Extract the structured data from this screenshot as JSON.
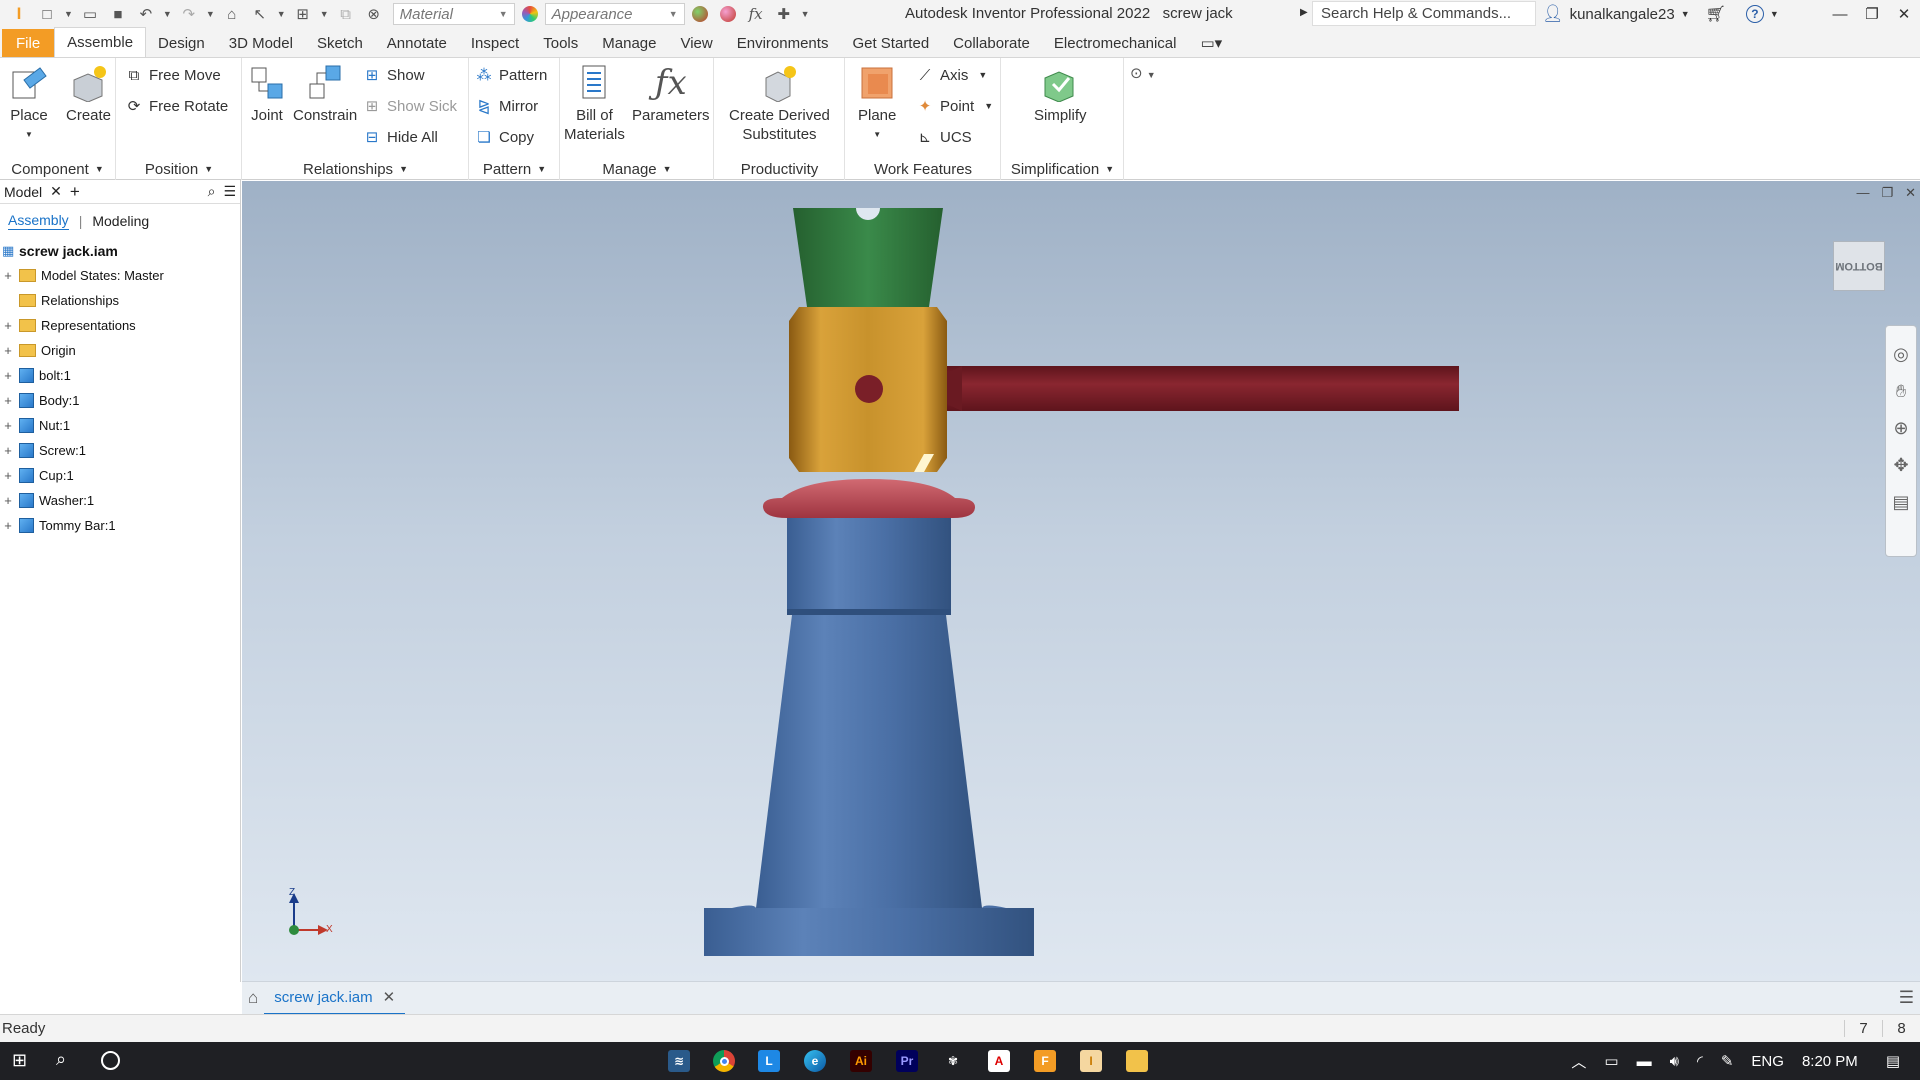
{
  "app": {
    "title": "Autodesk Inventor Professional 2022",
    "document": "screw jack",
    "colors": {
      "file_tab": "#f39c25",
      "accent": "#1a73c8",
      "viewport_top": "#9fb1c6",
      "viewport_bottom": "#dfe7f0"
    }
  },
  "qat": {
    "material_placeholder": "Material",
    "appearance_placeholder": "Appearance",
    "fx_label": "fx",
    "icons": [
      "inventor-logo-icon",
      "new-icon",
      "open-icon",
      "save-icon",
      "undo-icon",
      "redo-icon",
      "home-icon",
      "select-icon",
      "measure-icon",
      "color-icon",
      "clear-override-icon",
      "fx-icon",
      "plus-icon"
    ]
  },
  "search": {
    "placeholder": "Search Help & Commands..."
  },
  "user": {
    "name": "kunalkangale23"
  },
  "tabs": [
    "File",
    "Assemble",
    "Design",
    "3D Model",
    "Sketch",
    "Annotate",
    "Inspect",
    "Tools",
    "Manage",
    "View",
    "Environments",
    "Get Started",
    "Collaborate",
    "Electromechanical"
  ],
  "active_tab": "Assemble",
  "ribbon": {
    "component": {
      "label": "Component",
      "place": "Place",
      "create": "Create"
    },
    "position": {
      "label": "Position",
      "free_move": "Free Move",
      "free_rotate": "Free Rotate"
    },
    "relationships": {
      "label": "Relationships",
      "joint": "Joint",
      "constrain": "Constrain",
      "show": "Show",
      "show_sick": "Show Sick",
      "hide_all": "Hide All"
    },
    "pattern": {
      "label": "Pattern",
      "pattern": "Pattern",
      "mirror": "Mirror",
      "copy": "Copy"
    },
    "manage": {
      "label": "Manage",
      "bom_line1": "Bill of",
      "bom_line2": "Materials",
      "parameters": "Parameters"
    },
    "productivity": {
      "label": "Productivity",
      "cds_line1": "Create Derived",
      "cds_line2": "Substitutes"
    },
    "work_features": {
      "label": "Work Features",
      "plane": "Plane",
      "axis": "Axis",
      "point": "Point",
      "ucs": "UCS"
    },
    "simplification": {
      "label": "Simplification",
      "simplify": "Simplify"
    }
  },
  "browser": {
    "title": "Model",
    "tabs": [
      "Assembly",
      "Modeling"
    ],
    "root": "screw jack.iam",
    "nodes": [
      {
        "label": "Model States: Master",
        "icon": "folder",
        "expand": true
      },
      {
        "label": "Relationships",
        "icon": "folder",
        "expand": false
      },
      {
        "label": "Representations",
        "icon": "folder",
        "expand": true
      },
      {
        "label": "Origin",
        "icon": "folder",
        "expand": true
      },
      {
        "label": "bolt:1",
        "icon": "part",
        "expand": true
      },
      {
        "label": "Body:1",
        "icon": "part",
        "expand": true
      },
      {
        "label": "Nut:1",
        "icon": "part",
        "expand": true
      },
      {
        "label": "Screw:1",
        "icon": "part",
        "expand": true
      },
      {
        "label": "Cup:1",
        "icon": "part",
        "expand": true
      },
      {
        "label": "Washer:1",
        "icon": "part",
        "expand": true
      },
      {
        "label": "Tommy Bar:1",
        "icon": "part",
        "expand": true
      }
    ]
  },
  "viewport": {
    "viewcube_face": "BOTTOM",
    "axis_labels": {
      "z": "Z",
      "x": "X"
    },
    "part_colors": {
      "cup": "#2f7a3e",
      "nut": "#c8922c",
      "tommy_bar": "#7a1f28",
      "washer": "#c04a55",
      "body": "#4a6fa5"
    }
  },
  "doc_tab": {
    "label": "screw jack.iam"
  },
  "status": {
    "text": "Ready",
    "num1": "7",
    "num2": "8"
  },
  "taskbar": {
    "apps": [
      "windows-start-icon",
      "search-icon",
      "cortana-icon",
      "sharex-icon",
      "chrome-icon",
      "launcher-icon",
      "edge-icon",
      "illustrator-icon",
      "premiere-icon",
      "app-icon",
      "acrobat-icon",
      "fusion-icon",
      "inventor-icon",
      "explorer-icon"
    ],
    "lang": "ENG",
    "time": "8:20 PM"
  }
}
